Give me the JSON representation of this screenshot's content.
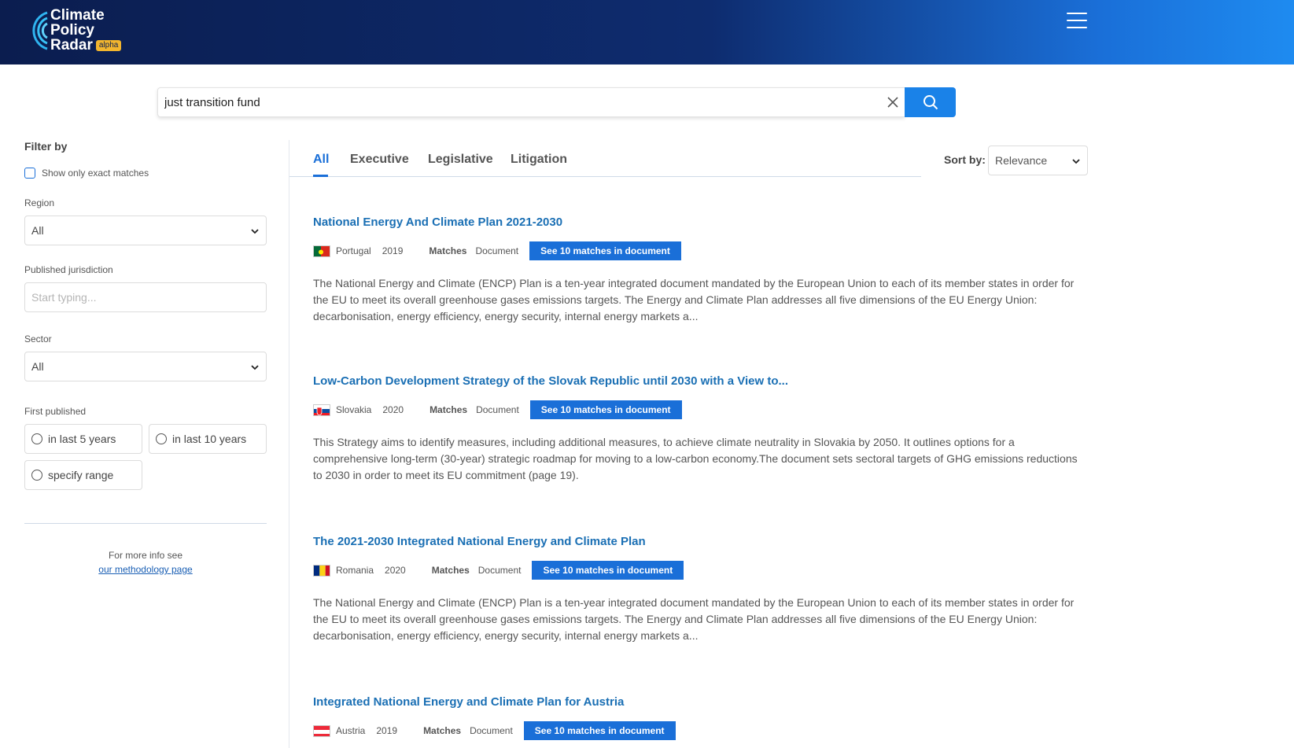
{
  "header": {
    "logo_lines": [
      "Climate",
      "Policy",
      "Radar"
    ],
    "alpha_label": "alpha",
    "menu_icon": "hamburger-menu-icon"
  },
  "search": {
    "value": "just transition fund",
    "clear_icon": "close-icon",
    "search_icon": "search-icon"
  },
  "sidebar": {
    "filter_title": "Filter by",
    "exact_matches_label": "Show only exact matches",
    "region_label": "Region",
    "region_value": "All",
    "jurisdiction_label": "Published jurisdiction",
    "jurisdiction_placeholder": "Start typing...",
    "sector_label": "Sector",
    "sector_value": "All",
    "first_published_label": "First published",
    "options": [
      "in last 5 years",
      "in last 10 years",
      "specify range"
    ],
    "more_info_text": "For more info see",
    "methodology_link": "our methodology page"
  },
  "tabs": [
    "All",
    "Executive",
    "Legislative",
    "Litigation"
  ],
  "active_tab": "All",
  "sort": {
    "label": "Sort by:",
    "value": "Relevance"
  },
  "results": [
    {
      "title": "National Energy And Climate Plan 2021-2030",
      "country": "Portugal",
      "year": "2019",
      "matches_label": "Matches",
      "doc_label": "Document",
      "button": "See 10 matches in document",
      "description": "The National Energy and Climate (ENCP) Plan is a ten-year integrated document mandated by the European Union to each of its member states in order for the EU to meet its overall greenhouse gases emissions targets.  The Energy and Climate Plan addresses all five dimensions of the EU Energy Union: decarbonisation, energy efficiency, energy security, internal energy markets a..."
    },
    {
      "title": "Low-Carbon Development Strategy of the Slovak Republic until 2030 with a View to...",
      "country": "Slovakia",
      "year": "2020",
      "matches_label": "Matches",
      "doc_label": "Document",
      "button": "See 10 matches in document",
      "description": "This Strategy aims to identify measures, including additional measures, to achieve climate neutrality in Slovakia by 2050. It outlines options for a comprehensive long-term (30-year) strategic roadmap for moving to a low-carbon economy.The document sets sectoral targets of GHG emissions reductions to 2030 in order to meet its EU commitment (page 19)."
    },
    {
      "title": "The 2021-2030 Integrated National Energy and Climate Plan",
      "country": "Romania",
      "year": "2020",
      "matches_label": "Matches",
      "doc_label": "Document",
      "button": "See 10 matches in document",
      "description": "The National Energy and Climate (ENCP) Plan is a ten-year integrated document mandated by the European Union to each of its member states in order for the EU to meet its overall greenhouse gases emissions targets.  The Energy and Climate Plan addresses all five dimensions of the EU Energy Union: decarbonisation, energy efficiency, energy security, internal energy markets a..."
    },
    {
      "title": "Integrated National Energy and Climate Plan for Austria",
      "country": "Austria",
      "year": "2019",
      "matches_label": "Matches",
      "doc_label": "Document",
      "button": "See 10 matches in document",
      "description": ""
    }
  ],
  "colors": {
    "accent": "#1a6fd8",
    "title_link": "#1a6fb4",
    "header_dark": "#0b1d4f",
    "alpha_badge": "#f2b52e"
  }
}
